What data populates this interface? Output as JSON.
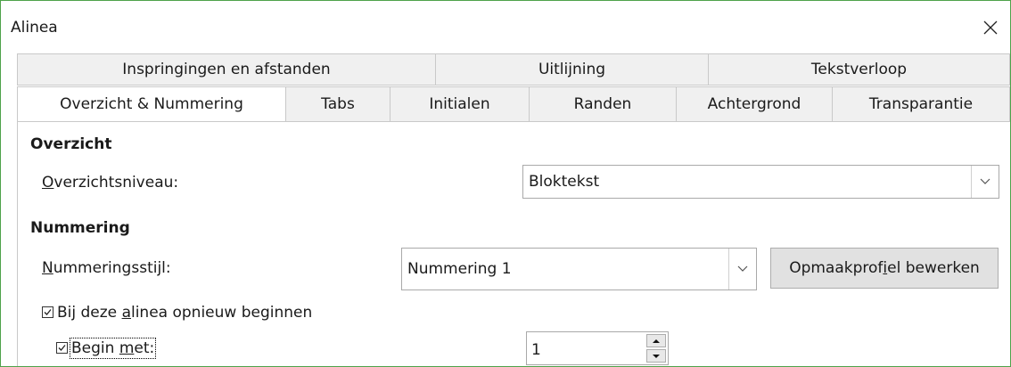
{
  "window": {
    "title": "Alinea"
  },
  "icons": {
    "close": "close-icon",
    "dropdown": "chevron-down-icon",
    "spin_up": "triangle-up-icon",
    "spin_down": "triangle-down-icon",
    "checkbox": "checkmark-icon"
  },
  "tabs": {
    "row1": [
      "Inspringingen en afstanden",
      "Uitlijning",
      "Tekstverloop"
    ],
    "row2": [
      "Overzicht & Nummering",
      "Tabs",
      "Initialen",
      "Randen",
      "Achtergrond",
      "Transparantie"
    ],
    "active": "Overzicht & Nummering"
  },
  "outline": {
    "heading": "Overzicht",
    "level_label_u": "O",
    "level_label_rest": "verzichtsniveau:",
    "level_value": "Bloktekst"
  },
  "numbering": {
    "heading": "Nummering",
    "style_label_u": "N",
    "style_label_rest": "ummeringsstijl:",
    "style_value": "Nummering 1",
    "edit_button_pre": "Opmaakprof",
    "edit_button_u": "i",
    "edit_button_post": "el bewerken",
    "restart_pre": "Bij deze ",
    "restart_u": "a",
    "restart_post": "linea opnieuw beginnen",
    "restart_checked": true,
    "begin_pre": "Begin ",
    "begin_u": "m",
    "begin_post": "et:",
    "begin_checked": true,
    "begin_value": "1"
  }
}
